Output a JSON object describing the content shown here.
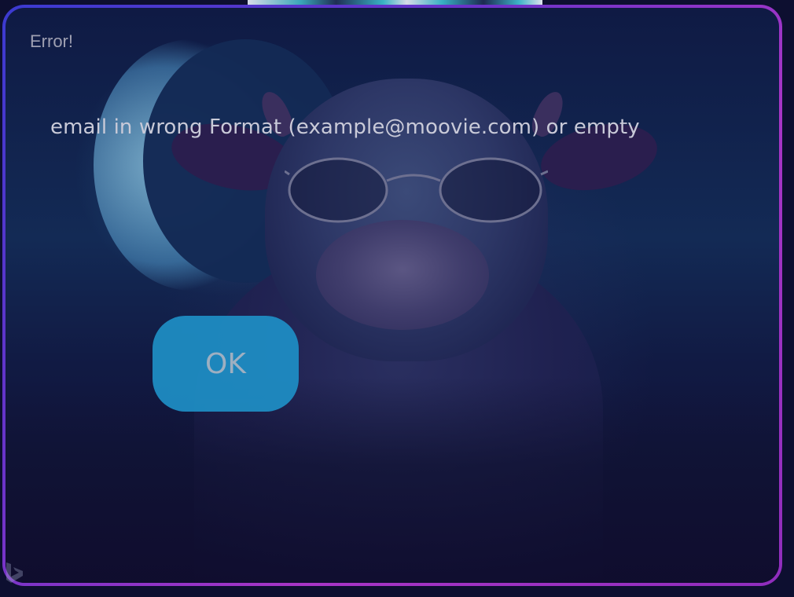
{
  "dialog": {
    "title": "Error!",
    "message": "email in wrong Format (example@moovie.com) or empty",
    "ok_label": "OK"
  },
  "colors": {
    "border_start": "#3b3ad0",
    "border_end": "#a835c6",
    "button": "#1e8fc6",
    "background": "#132a55"
  },
  "icons": {
    "corner_logo": "bing-logo-icon"
  }
}
